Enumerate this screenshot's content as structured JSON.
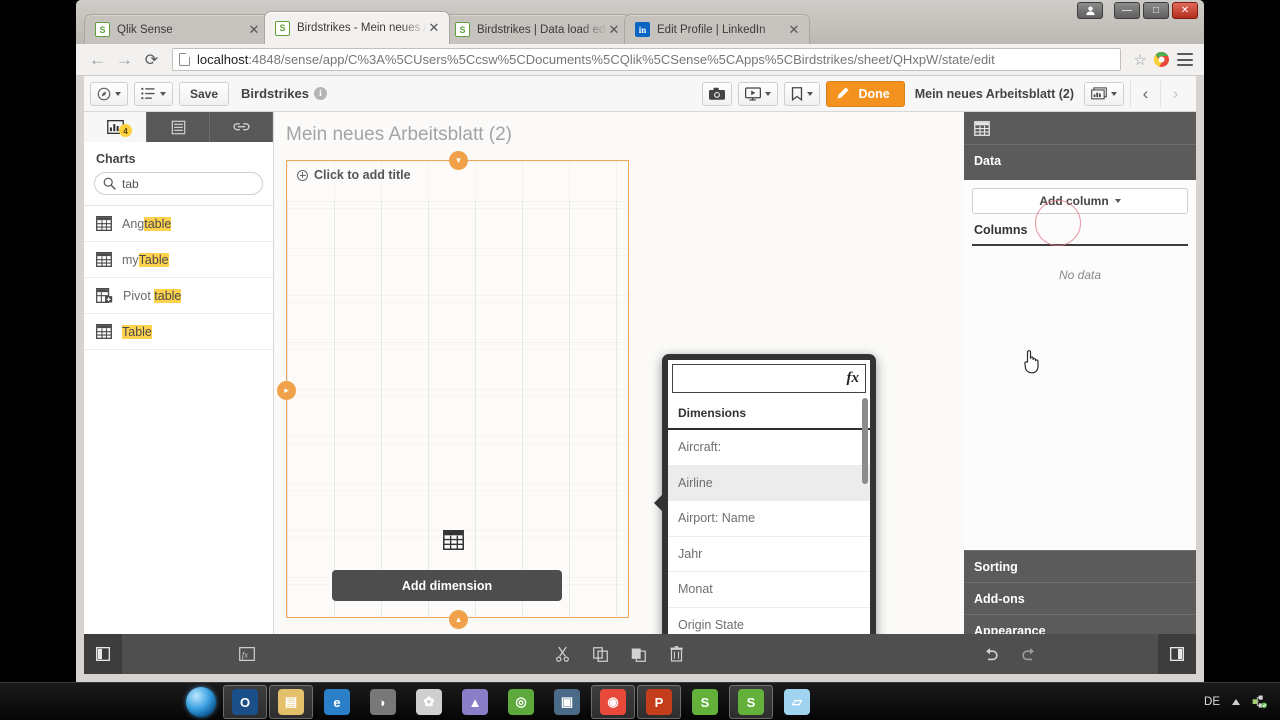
{
  "window": {
    "buttons": {
      "user": "user-icon",
      "minimize": "—",
      "maximize": "□",
      "close": "✕"
    }
  },
  "browser": {
    "tabs": [
      {
        "title": "Qlik Sense",
        "favicon": "qlik-favicon",
        "active": false,
        "close": "✕"
      },
      {
        "title": "Birdstrikes - Mein neues A",
        "favicon": "qlik-favicon",
        "active": true,
        "close": "✕"
      },
      {
        "title": "Birdstrikes | Data load ed",
        "favicon": "qlik-favicon",
        "active": false,
        "close": "✕"
      },
      {
        "title": "Edit Profile | LinkedIn",
        "favicon": "linkedin-favicon",
        "active": false,
        "close": "✕"
      }
    ],
    "nav": {
      "back": "←",
      "forward": "→",
      "reload": "⟳"
    },
    "url_host": "localhost",
    "url_rest": ":4848/sense/app/C%3A%5CUsers%5Ccsw%5CDocuments%5CQlik%5CSense%5CApps%5CBirdstrikes/sheet/QHxpW/state/edit",
    "star": "☆",
    "menu": "chrome-menu-icon"
  },
  "qlik": {
    "toolbar": {
      "navigation_label": "navigation-menu",
      "sheets_label": "sheet-list-menu",
      "save_label": "Save",
      "app_name": "Birdstrikes",
      "info_label": "i",
      "snapshot_label": "snapshot-icon",
      "story_label": "storytelling-icon",
      "bookmark_label": "bookmark-icon",
      "done_label": "Done",
      "sheet_name": "Mein neues Arbeitsblatt (2)",
      "sheet_overview_label": "sheet-overview-icon",
      "prev_label": "‹",
      "next_label": "›"
    },
    "left_panel": {
      "tabs": [
        {
          "name": "charts-tab",
          "icon": "bar-chart-icon",
          "badge": "4",
          "active": true
        },
        {
          "name": "fields-tab",
          "icon": "fields-icon",
          "badge": "",
          "active": false
        },
        {
          "name": "master-items-tab",
          "icon": "link-icon",
          "badge": "",
          "active": false
        }
      ],
      "heading": "Charts",
      "search_value": "tab",
      "search_placeholder": "",
      "search_icon": "search-icon",
      "clear_icon": "✕",
      "items": [
        {
          "icon": "table-icon",
          "pre": "Ang",
          "match": "table",
          "post": ""
        },
        {
          "icon": "table-icon",
          "pre": "my",
          "match": "Table",
          "post": ""
        },
        {
          "icon": "pivot-table-icon",
          "pre": "Pivot ",
          "match": "table",
          "post": ""
        },
        {
          "icon": "table-icon",
          "pre": "",
          "match": "Table",
          "post": ""
        }
      ]
    },
    "canvas": {
      "sheet_title": "Mein neues Arbeitsblatt (2)",
      "object_title": "Click to add title",
      "object_icon": "table-icon",
      "add_dimension_label": "Add dimension",
      "handle_top": "▾",
      "handle_left": "▸",
      "handle_bottom": "▴"
    },
    "dimension_popup": {
      "search_value": "",
      "search_placeholder": "",
      "fx_label": "fx",
      "heading": "Dimensions",
      "items": [
        {
          "label": "Aircraft:",
          "hover": false
        },
        {
          "label": "Airline",
          "hover": true
        },
        {
          "label": "Airport: Name",
          "hover": false
        },
        {
          "label": "Jahr",
          "hover": false
        },
        {
          "label": "Monat",
          "hover": false
        },
        {
          "label": "Origin State",
          "hover": false
        }
      ]
    },
    "right_panel": {
      "viz_icon": "table-icon",
      "data_heading": "Data",
      "add_column_label": "Add column",
      "columns_heading": "Columns",
      "no_data_label": "No data",
      "sections": [
        {
          "label": "Sorting"
        },
        {
          "label": "Add-ons"
        },
        {
          "label": "Appearance"
        }
      ]
    },
    "bottom_bar": {
      "left_toggle": "left-panel-toggle-icon",
      "expression_editor": "expression-editor-icon",
      "cut": "cut-icon",
      "copy": "copy-icon",
      "paste": "paste-icon",
      "delete": "trash-icon",
      "undo": "undo-icon",
      "redo": "redo-icon",
      "right_toggle": "right-panel-toggle-icon"
    }
  },
  "taskbar": {
    "start_label": "start-orb",
    "items": [
      {
        "name": "outlook",
        "glyph": "O",
        "color": "#1b4f8a",
        "pressed": true
      },
      {
        "name": "file-explorer",
        "glyph": "▤",
        "color": "#e3c06a",
        "pressed": true
      },
      {
        "name": "internet-explorer",
        "glyph": "e",
        "color": "#2a7fc9",
        "pressed": false
      },
      {
        "name": "app-gray",
        "glyph": "◗",
        "color": "#787878",
        "pressed": false
      },
      {
        "name": "settings",
        "glyph": "✿",
        "color": "#cfcfcf",
        "pressed": false
      },
      {
        "name": "keepass",
        "glyph": "▲",
        "color": "#8a7ec8",
        "pressed": false
      },
      {
        "name": "qlik-sense",
        "glyph": "◎",
        "color": "#5ea93c",
        "pressed": false
      },
      {
        "name": "monitor-app",
        "glyph": "▣",
        "color": "#4b6a88",
        "pressed": false
      },
      {
        "name": "chrome",
        "glyph": "◉",
        "color": "#e8493a",
        "pressed": true
      },
      {
        "name": "powerpoint",
        "glyph": "P",
        "color": "#c43e1c",
        "pressed": true
      },
      {
        "name": "qlik-app-1",
        "glyph": "S",
        "color": "#63b03a",
        "pressed": false
      },
      {
        "name": "qlik-app-2",
        "glyph": "S",
        "color": "#63b03a",
        "pressed": true
      },
      {
        "name": "notepad",
        "glyph": "▱",
        "color": "#9fd3ef",
        "pressed": false
      }
    ],
    "language": "DE",
    "tray_show_hidden": "▲",
    "tray_icon": "network-icon"
  }
}
